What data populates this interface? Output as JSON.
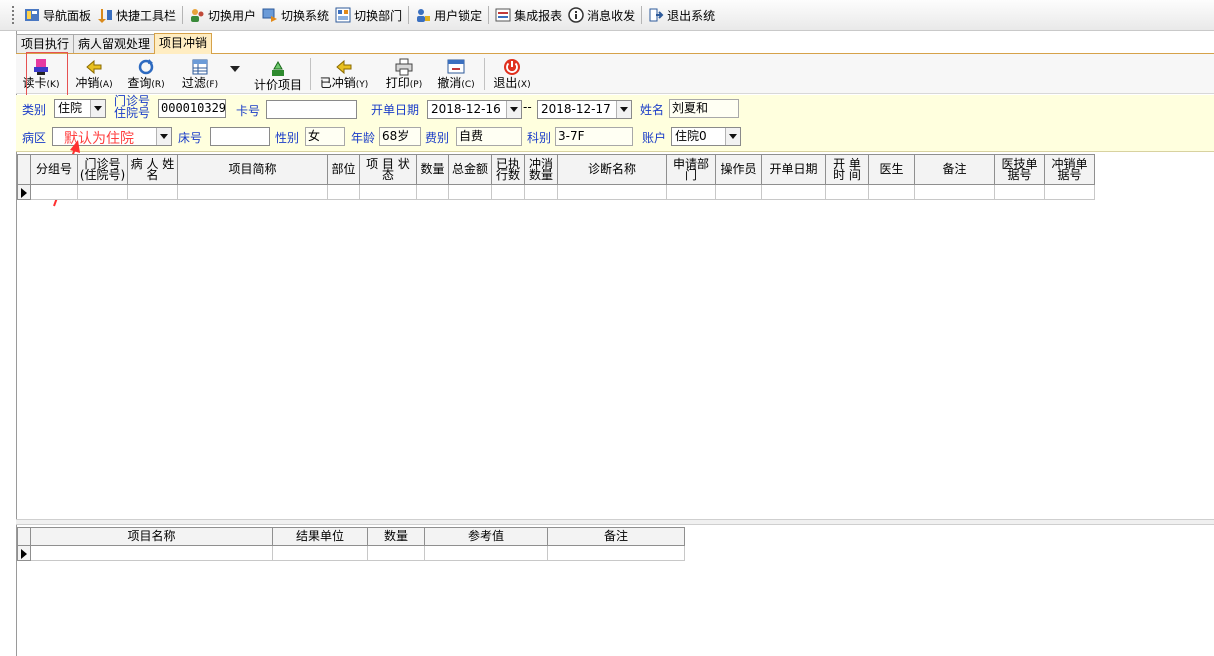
{
  "menubar": {
    "items": [
      {
        "label": "导航面板",
        "icon": "navigation-panel-icon"
      },
      {
        "label": "快捷工具栏",
        "icon": "quick-toolbar-icon"
      },
      {
        "label": "切换用户",
        "icon": "switch-user-icon"
      },
      {
        "label": "切换系统",
        "icon": "switch-system-icon"
      },
      {
        "label": "切换部门",
        "icon": "switch-department-icon"
      },
      {
        "label": "用户锁定",
        "icon": "user-lock-icon"
      },
      {
        "label": "集成报表",
        "icon": "report-icon"
      },
      {
        "label": "消息收发",
        "icon": "message-icon"
      },
      {
        "label": "退出系统",
        "icon": "exit-system-icon"
      }
    ]
  },
  "tabs": [
    {
      "label": "项目执行"
    },
    {
      "label": "病人留观处理"
    },
    {
      "label": "项目冲销"
    }
  ],
  "toolbar": {
    "read_card": {
      "label": "读卡",
      "key": "(K)"
    },
    "reverse": {
      "label": "冲销",
      "key": "(A)"
    },
    "query": {
      "label": "查询",
      "key": "(R)"
    },
    "filter": {
      "label": "过滤",
      "key": "(F)"
    },
    "pricing": {
      "label": "计价项目",
      "key": ""
    },
    "reversed": {
      "label": "已冲销",
      "key": "(Y)"
    },
    "print": {
      "label": "打印",
      "key": "(P)"
    },
    "cancel": {
      "label": "撤消",
      "key": "(C)"
    },
    "exit": {
      "label": "退出",
      "key": "(X)"
    }
  },
  "filters": {
    "category_label": "类别",
    "category_value": "住院",
    "outpatient_label_line1": "门诊号",
    "outpatient_label_line2": "住院号",
    "outpatient_value": "000010329",
    "card_label": "卡号",
    "card_value": "",
    "date_label": "开单日期",
    "date_from": "2018-12-16",
    "date_separator": "--",
    "date_to": "2018-12-17",
    "name_label": "姓名",
    "name_value": "刘夏和",
    "ward_label": "病区",
    "ward_value": "",
    "bed_label": "床号",
    "bed_value": "",
    "gender_label": "性别",
    "gender_value": "女",
    "age_label": "年龄",
    "age_value": "68岁",
    "fee_label": "费别",
    "fee_value": "自费",
    "dept_label": "科别",
    "dept_value": "3-7F",
    "account_label": "账户",
    "account_value": "住院0"
  },
  "annotation": "默认为住院",
  "main_grid": {
    "columns": [
      {
        "label": "分组号"
      },
      {
        "label": "门诊号(住院号)"
      },
      {
        "label": "病 人 姓 名"
      },
      {
        "label": "项目简称"
      },
      {
        "label": "部位"
      },
      {
        "label": "项 目 状 态"
      },
      {
        "label": "数量"
      },
      {
        "label": "总金额"
      },
      {
        "label": "已执行数"
      },
      {
        "label": "冲消数量"
      },
      {
        "label": "诊断名称"
      },
      {
        "label": "申请部门"
      },
      {
        "label": "操作员"
      },
      {
        "label": "开单日期"
      },
      {
        "label": "开 单 时 间"
      },
      {
        "label": "医生"
      },
      {
        "label": "备注"
      },
      {
        "label": "医技单据号"
      },
      {
        "label": "冲销单据号"
      }
    ]
  },
  "result_grid": {
    "columns": [
      {
        "label": "项目名称"
      },
      {
        "label": "结果单位"
      },
      {
        "label": "数量"
      },
      {
        "label": "参考值"
      },
      {
        "label": "备注"
      }
    ]
  },
  "colors": {
    "filter_bg": "#ffffde",
    "label_blue": "#1a3cc8",
    "active_tab": "#ffedc2",
    "annotation_red": "#ff4040"
  }
}
